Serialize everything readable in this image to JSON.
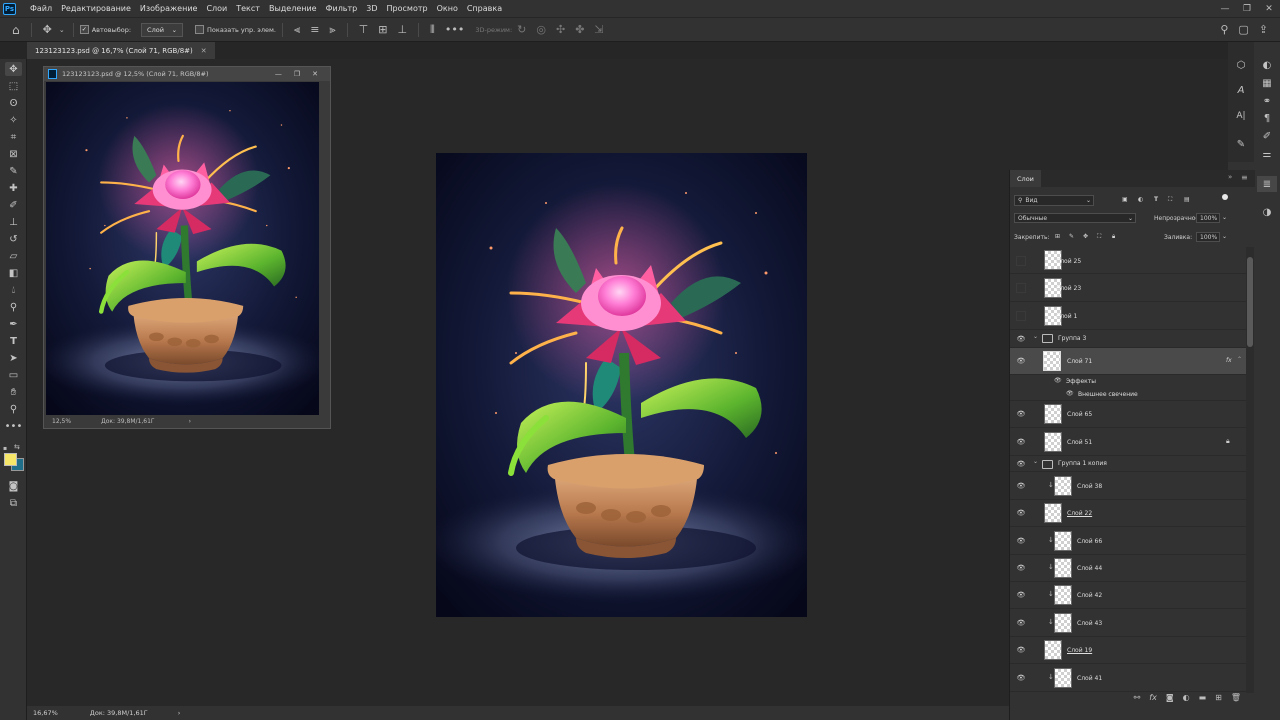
{
  "app": {
    "logo": "Ps"
  },
  "menu": [
    "Файл",
    "Редактирование",
    "Изображение",
    "Слои",
    "Текст",
    "Выделение",
    "Фильтр",
    "3D",
    "Просмотр",
    "Окно",
    "Справка"
  ],
  "window_controls": {
    "minimize": "—",
    "maximize": "❐",
    "close": "✕"
  },
  "options_bar": {
    "autoselect_label": "Автовыбор:",
    "autoselect_value": "Слой",
    "show_transform_label": "Показать упр. элем.",
    "mode_3d_label": "3D-режим:"
  },
  "doc_tab": {
    "title": "123123123.psd @ 16,7% (Слой 71, RGB/8#)",
    "close": "✕"
  },
  "float_window": {
    "title": "123123123.psd @ 12,5% (Слой 71, RGB/8#)",
    "zoom": "12,5%",
    "doc_size": "Док: 39,8M/1,61Г",
    "arrow": "›"
  },
  "status_bar": {
    "zoom": "16,67%",
    "doc_size": "Док: 39,8M/1,61Г",
    "arrow": "›"
  },
  "colors": {
    "foreground": "#f5e66a",
    "background": "#1f6f8a"
  },
  "layers_panel": {
    "tab_label": "Слои",
    "filter_kind": "Вид",
    "blend_mode": "Обычные",
    "opacity_label": "Непрозрачность:",
    "opacity_value": "100%",
    "lock_label": "Закрепить:",
    "fill_label": "Заливка:",
    "fill_value": "100%",
    "layers": [
      {
        "name": "Слой 25",
        "visible": false
      },
      {
        "name": "Слой 23",
        "visible": false
      },
      {
        "name": "Слой 1",
        "visible": false
      },
      {
        "name": "Группа 3",
        "visible": true
      },
      {
        "name": "Слой 71",
        "visible": true,
        "fx": "fx"
      },
      {
        "name": "Эффекты"
      },
      {
        "name": "Внешнее свечение"
      },
      {
        "name": "Слой 65",
        "visible": true
      },
      {
        "name": "Слой 51",
        "visible": true,
        "locked": true
      },
      {
        "name": "Группа 1 копия",
        "visible": true
      },
      {
        "name": "Слой 38",
        "visible": true
      },
      {
        "name": "Слой 22",
        "visible": true
      },
      {
        "name": "Слой 66",
        "visible": true
      },
      {
        "name": "Слой 44",
        "visible": true
      },
      {
        "name": "Слой 42",
        "visible": true
      },
      {
        "name": "Слой 43",
        "visible": true
      },
      {
        "name": "Слой 19",
        "visible": true
      },
      {
        "name": "Слой 41",
        "visible": true
      }
    ]
  }
}
